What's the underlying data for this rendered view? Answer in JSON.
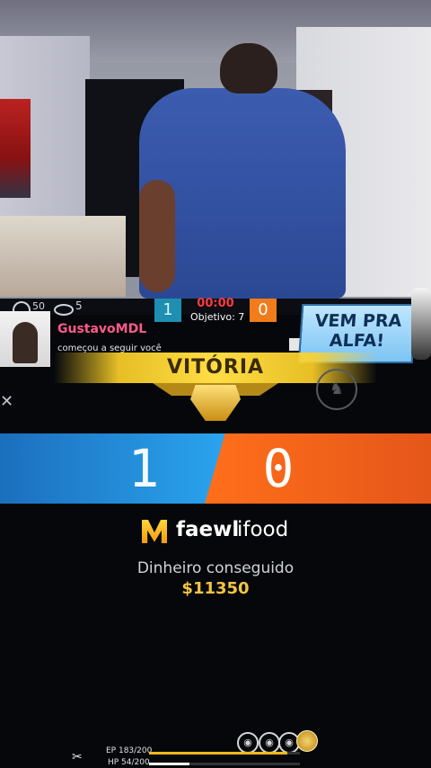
{
  "hud": {
    "ping": "50",
    "viewers": "5",
    "team_blue_score": "1",
    "team_orange_score": "0",
    "timer": "00:00",
    "objective": "Objetivo: 7"
  },
  "notification": {
    "username": "GustavoMDL",
    "action": "começou a seguir você"
  },
  "banner": {
    "text": "VEM PRA ALFA!"
  },
  "result": {
    "title": "VITÓRIA",
    "blue_score": "1",
    "orange_score": "0"
  },
  "sponsors": {
    "brand1": "faewl",
    "brand2": "ifood"
  },
  "reward": {
    "label": "Dinheiro conseguido",
    "value": "$11350"
  },
  "player": {
    "ep_text": "EP 183/200",
    "hp_text": "HP 54/200",
    "ep_fraction": 0.915,
    "hp_fraction": 0.27
  },
  "colors": {
    "blue_team": "#2aa4ef",
    "orange_team": "#ff6f1a",
    "victory_gold": "#ffdd44",
    "money_gold": "#f4c542",
    "username_pink": "#ff5a8a"
  }
}
